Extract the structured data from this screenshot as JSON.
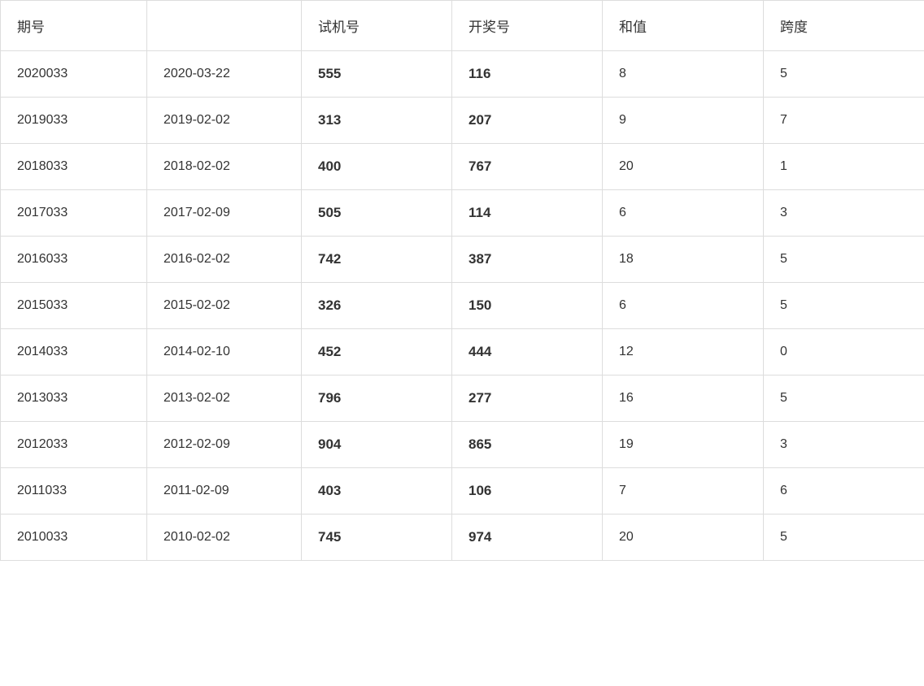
{
  "table": {
    "headers": [
      "期号",
      "",
      "试机号",
      "开奖号",
      "和值",
      "跨度"
    ],
    "rows": [
      {
        "qihao": "2020033",
        "date": "2020-03-22",
        "shiji": "555",
        "kaijian": "116",
        "hezhi": "8",
        "kuadu": "5"
      },
      {
        "qihao": "2019033",
        "date": "2019-02-02",
        "shiji": "313",
        "kaijian": "207",
        "hezhi": "9",
        "kuadu": "7"
      },
      {
        "qihao": "2018033",
        "date": "2018-02-02",
        "shiji": "400",
        "kaijian": "767",
        "hezhi": "20",
        "kuadu": "1"
      },
      {
        "qihao": "2017033",
        "date": "2017-02-09",
        "shiji": "505",
        "kaijian": "114",
        "hezhi": "6",
        "kuadu": "3"
      },
      {
        "qihao": "2016033",
        "date": "2016-02-02",
        "shiji": "742",
        "kaijian": "387",
        "hezhi": "18",
        "kuadu": "5"
      },
      {
        "qihao": "2015033",
        "date": "2015-02-02",
        "shiji": "326",
        "kaijian": "150",
        "hezhi": "6",
        "kuadu": "5"
      },
      {
        "qihao": "2014033",
        "date": "2014-02-10",
        "shiji": "452",
        "kaijian": "444",
        "hezhi": "12",
        "kuadu": "0"
      },
      {
        "qihao": "2013033",
        "date": "2013-02-02",
        "shiji": "796",
        "kaijian": "277",
        "hezhi": "16",
        "kuadu": "5"
      },
      {
        "qihao": "2012033",
        "date": "2012-02-09",
        "shiji": "904",
        "kaijian": "865",
        "hezhi": "19",
        "kuadu": "3"
      },
      {
        "qihao": "2011033",
        "date": "2011-02-09",
        "shiji": "403",
        "kaijian": "106",
        "hezhi": "7",
        "kuadu": "6"
      },
      {
        "qihao": "2010033",
        "date": "2010-02-02",
        "shiji": "745",
        "kaijian": "974",
        "hezhi": "20",
        "kuadu": "5"
      }
    ]
  }
}
